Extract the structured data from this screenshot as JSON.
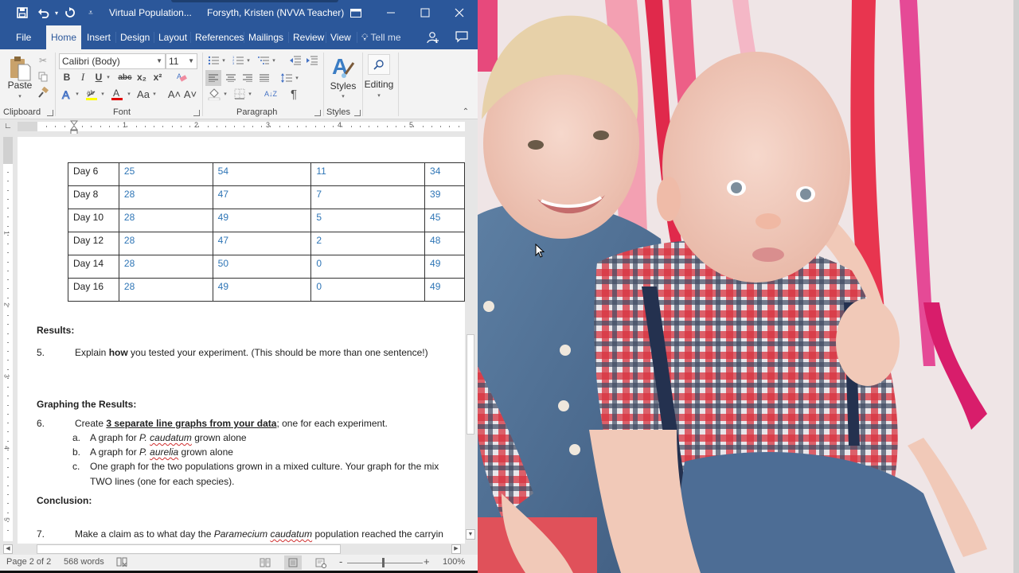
{
  "titlebar": {
    "document_title": "Virtual Population...",
    "user": "Forsyth, Kristen (NVVA Teacher)",
    "quick_access": [
      "save-icon",
      "undo-icon",
      "redo-icon",
      "customize-icon"
    ],
    "window_controls": [
      "ribbon-display-options-icon",
      "minimize-icon",
      "maximize-icon",
      "close-icon"
    ]
  },
  "tabs": [
    {
      "label": "File",
      "active": false
    },
    {
      "label": "Home",
      "active": true
    },
    {
      "label": "Insert",
      "active": false
    },
    {
      "label": "Design",
      "active": false
    },
    {
      "label": "Layout",
      "active": false
    },
    {
      "label": "References",
      "active": false
    },
    {
      "label": "Mailings",
      "active": false
    },
    {
      "label": "Review",
      "active": false
    },
    {
      "label": "View",
      "active": false
    }
  ],
  "tell_me": "Tell me",
  "ribbon": {
    "clipboard": {
      "label": "Clipboard",
      "paste": "Paste"
    },
    "font": {
      "label": "Font",
      "font_name": "Calibri (Body)",
      "font_size": "11",
      "bold": "B",
      "italic": "I",
      "underline": "U",
      "strikethrough": "abc",
      "subscript": "x₂",
      "superscript": "x²",
      "change_case": "Aa",
      "grow": "A˄",
      "shrink": "A˅",
      "highlight_color": "#ffff00",
      "font_color": "#e00000"
    },
    "paragraph": {
      "label": "Paragraph",
      "pilcrow": "¶",
      "sort": "A↓Z"
    },
    "styles": {
      "label": "Styles",
      "button": "Styles"
    },
    "editing": {
      "button": "Editing"
    }
  },
  "ruler": {
    "numbers": [
      "1",
      "2",
      "3",
      "4",
      "5"
    ],
    "vertical_numbers": [
      "1",
      "2",
      "3",
      "4",
      "5"
    ]
  },
  "document": {
    "table": [
      {
        "day": "Day 6",
        "values": [
          "25",
          "54",
          "11",
          "34"
        ]
      },
      {
        "day": "Day 8",
        "values": [
          "28",
          "47",
          "7",
          "39"
        ]
      },
      {
        "day": "Day 10",
        "values": [
          "28",
          "49",
          "5",
          "45"
        ]
      },
      {
        "day": "Day 12",
        "values": [
          "28",
          "47",
          "2",
          "48"
        ]
      },
      {
        "day": "Day 14",
        "values": [
          "28",
          "50",
          "0",
          "49"
        ]
      },
      {
        "day": "Day 16",
        "values": [
          "28",
          "49",
          "0",
          "49"
        ]
      }
    ],
    "results_heading": "Results:",
    "q5": {
      "num": "5.",
      "pre": "Explain ",
      "bold": "how",
      "post": " you tested your experiment.  (This should be more than one sentence!)"
    },
    "graphing_heading": "Graphing the Results:",
    "q6": {
      "num": "6.",
      "pre": "Create ",
      "underlined": "3 separate line graphs from your data",
      "post": "; one for each experiment.",
      "a": {
        "marker": "a.",
        "pre": "A graph for ",
        "genus": "P. ",
        "species": "caudatum",
        "post": " grown alone"
      },
      "b": {
        "marker": "b.",
        "pre": "A graph for ",
        "genus": "P. ",
        "species": "aurelia",
        "post": " grown alone"
      },
      "c": {
        "marker": "c.",
        "line1": "One graph for the two populations grown in a mixed culture.  Your graph for the mix",
        "line2": "TWO lines (one for each species)."
      }
    },
    "conclusion_heading": "Conclusion:",
    "q7": {
      "num": "7.",
      "pre": "Make a claim as to what day the ",
      "genus": "Paramecium ",
      "species": "caudatum",
      "post": " population reached the carryin"
    }
  },
  "statusbar": {
    "page": "Page 2 of 2",
    "words": "568 words",
    "zoom_minus": "-",
    "zoom_plus": "+",
    "zoom": "100%",
    "zoom_level_percent": 100,
    "active_view": "print-layout"
  },
  "photo": {
    "description": "Two young boys posing together; older boy in denim shirt with arm around baby in red-and-navy plaid shirt with suspenders, pink and red streamer backdrop"
  },
  "colors": {
    "word_blue": "#2b579a",
    "table_value_blue": "#2e75b6",
    "ribbon_bg": "#f3f3f3"
  }
}
